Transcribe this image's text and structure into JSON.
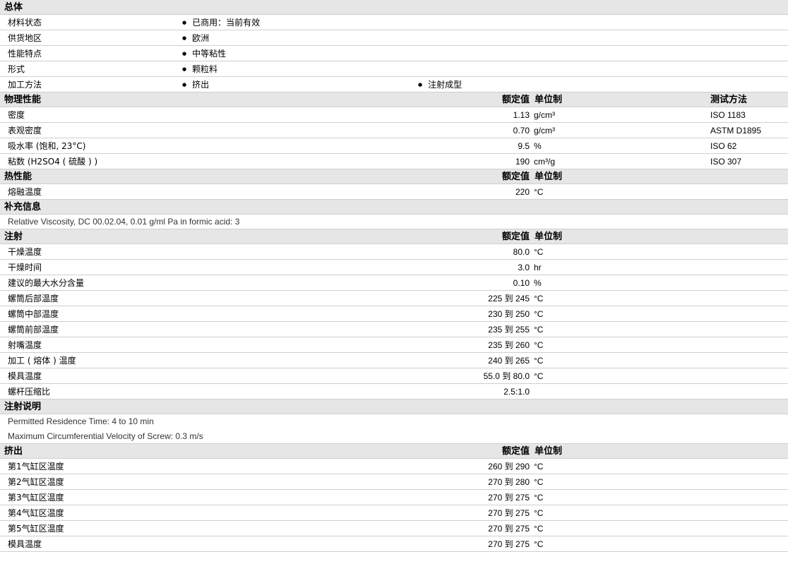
{
  "header_labels": {
    "nominal": "额定值",
    "unit": "单位制",
    "method": "测试方法"
  },
  "general": {
    "title": "总体",
    "rows": [
      {
        "label": "材料状态",
        "values": [
          "已商用：当前有效"
        ]
      },
      {
        "label": "供货地区",
        "values": [
          "欧洲"
        ]
      },
      {
        "label": "性能特点",
        "values": [
          "中等粘性"
        ]
      },
      {
        "label": "形式",
        "values": [
          "颗粒料"
        ]
      },
      {
        "label": "加工方法",
        "values": [
          "挤出",
          "注射成型"
        ]
      }
    ]
  },
  "physical": {
    "title": "物理性能",
    "rows": [
      {
        "label": "密度",
        "value": "1.13",
        "unit": "g/cm³",
        "method": "ISO 1183"
      },
      {
        "label": "表观密度",
        "value": "0.70",
        "unit": "g/cm³",
        "method": "ASTM D1895"
      },
      {
        "label": "吸水率 (饱和, 23°C)",
        "value": "9.5",
        "unit": "%",
        "method": "ISO 62"
      },
      {
        "label": "粘数 (H2SO4 ( 硫酸 ) )",
        "value": "190",
        "unit": "cm³/g",
        "method": "ISO 307"
      }
    ]
  },
  "thermal": {
    "title": "热性能",
    "rows": [
      {
        "label": "熔融温度",
        "value": "220",
        "unit": "°C"
      }
    ]
  },
  "supplement": {
    "title": "补充信息",
    "notes": [
      "Relative Viscosity, DC 00.02.04, 0.01 g/ml Pa in formic acid: 3"
    ]
  },
  "injection": {
    "title": "注射",
    "rows": [
      {
        "label": "干燥温度",
        "value": "80.0",
        "unit": "°C"
      },
      {
        "label": "干燥时间",
        "value": "3.0",
        "unit": "hr"
      },
      {
        "label": "建议的最大水分含量",
        "value": "0.10",
        "unit": "%"
      },
      {
        "label": "螺筒后部温度",
        "value": "225 到  245",
        "unit": "°C"
      },
      {
        "label": "螺筒中部温度",
        "value": "230 到  250",
        "unit": "°C"
      },
      {
        "label": "螺筒前部温度",
        "value": "235 到  255",
        "unit": "°C"
      },
      {
        "label": "射嘴温度",
        "value": "235 到  260",
        "unit": "°C"
      },
      {
        "label": "加工 ( 熔体 ) 温度",
        "value": "240 到  265",
        "unit": "°C"
      },
      {
        "label": "模具温度",
        "value": "55.0 到  80.0",
        "unit": "°C"
      },
      {
        "label": "螺杆压缩比",
        "value": "2.5:1.0",
        "unit": ""
      }
    ]
  },
  "injection_notes": {
    "title": "注射说明",
    "notes": [
      "Permitted Residence Time: 4 to 10 min",
      "Maximum Circumferential Velocity of Screw: 0.3 m/s"
    ]
  },
  "extrusion": {
    "title": "挤出",
    "rows": [
      {
        "label": "第1气缸区温度",
        "value": "260 到  290",
        "unit": "°C"
      },
      {
        "label": "第2气缸区温度",
        "value": "270 到  280",
        "unit": "°C"
      },
      {
        "label": "第3气缸区温度",
        "value": "270 到  275",
        "unit": "°C"
      },
      {
        "label": "第4气缸区温度",
        "value": "270 到  275",
        "unit": "°C"
      },
      {
        "label": "第5气缸区温度",
        "value": "270 到  275",
        "unit": "°C"
      },
      {
        "label": "模具温度",
        "value": "270 到  275",
        "unit": "°C"
      }
    ]
  }
}
